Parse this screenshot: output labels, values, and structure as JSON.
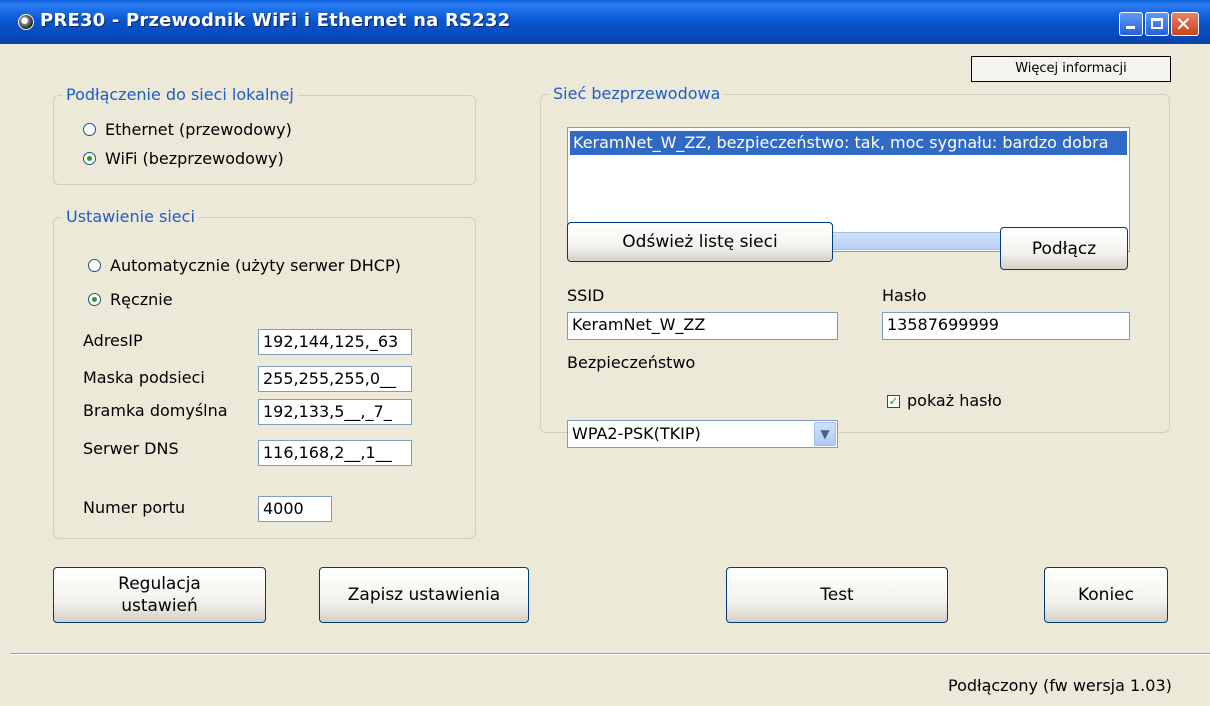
{
  "window": {
    "title": "PRE30 - Przewodnik WiFi i Ethernet na RS232",
    "icon": "app-icon",
    "controls": [
      "minimize-icon",
      "maximize-icon",
      "close-icon"
    ]
  },
  "more_info_button": "Więcej informacji",
  "local_network": {
    "title": "Podłączenie do sieci lokalnej",
    "options": [
      {
        "label": "Ethernet (przewodowy)",
        "selected": false
      },
      {
        "label": "WiFi (bezprzewodowy)",
        "selected": true
      }
    ]
  },
  "network_settings": {
    "title": "Ustawienie sieci",
    "options": [
      {
        "label": "Automatycznie (użyty serwer DHCP)",
        "selected": false
      },
      {
        "label": "Ręcznie",
        "selected": true
      }
    ],
    "fields": [
      {
        "label": "AdresIP",
        "value": "192,144,125,_63"
      },
      {
        "label": "Maska podsieci",
        "value": "255,255,255,0__"
      },
      {
        "label": "Bramka domyślna",
        "value": "192,133,5__,_7_"
      },
      {
        "label": "Serwer DNS",
        "value": "116,168,2__,1__"
      }
    ],
    "port_label": "Numer portu",
    "port_value": "4000"
  },
  "wireless": {
    "title": "Sieć bezprzewodowa",
    "networks": [
      "KeramNet_W_ZZ, bezpieczeństwo: tak, moc sygnału: bardzo dobra"
    ],
    "refresh_button": "Odśwież listę sieci",
    "connect_button": "Podłącz",
    "ssid_label": "SSID",
    "ssid_value": "KeramNet_W_ZZ",
    "password_label": "Hasło",
    "password_value": "13587699999",
    "security_label": "Bezpieczeństwo",
    "security_value": "WPA2-PSK(TKIP)",
    "show_password_label": "pokaż hasło",
    "show_password_checked": true
  },
  "buttons": {
    "regulation": "Regulacja ustawień",
    "save": "Zapisz ustawienia",
    "test": "Test",
    "exit": "Koniec"
  },
  "status": "Podłączony (fw wersja 1.03)",
  "colors": {
    "titlebar": "#0a58d0",
    "group_title": "#1e5cc8",
    "selection": "#316ac5",
    "background": "#ece9d8"
  }
}
